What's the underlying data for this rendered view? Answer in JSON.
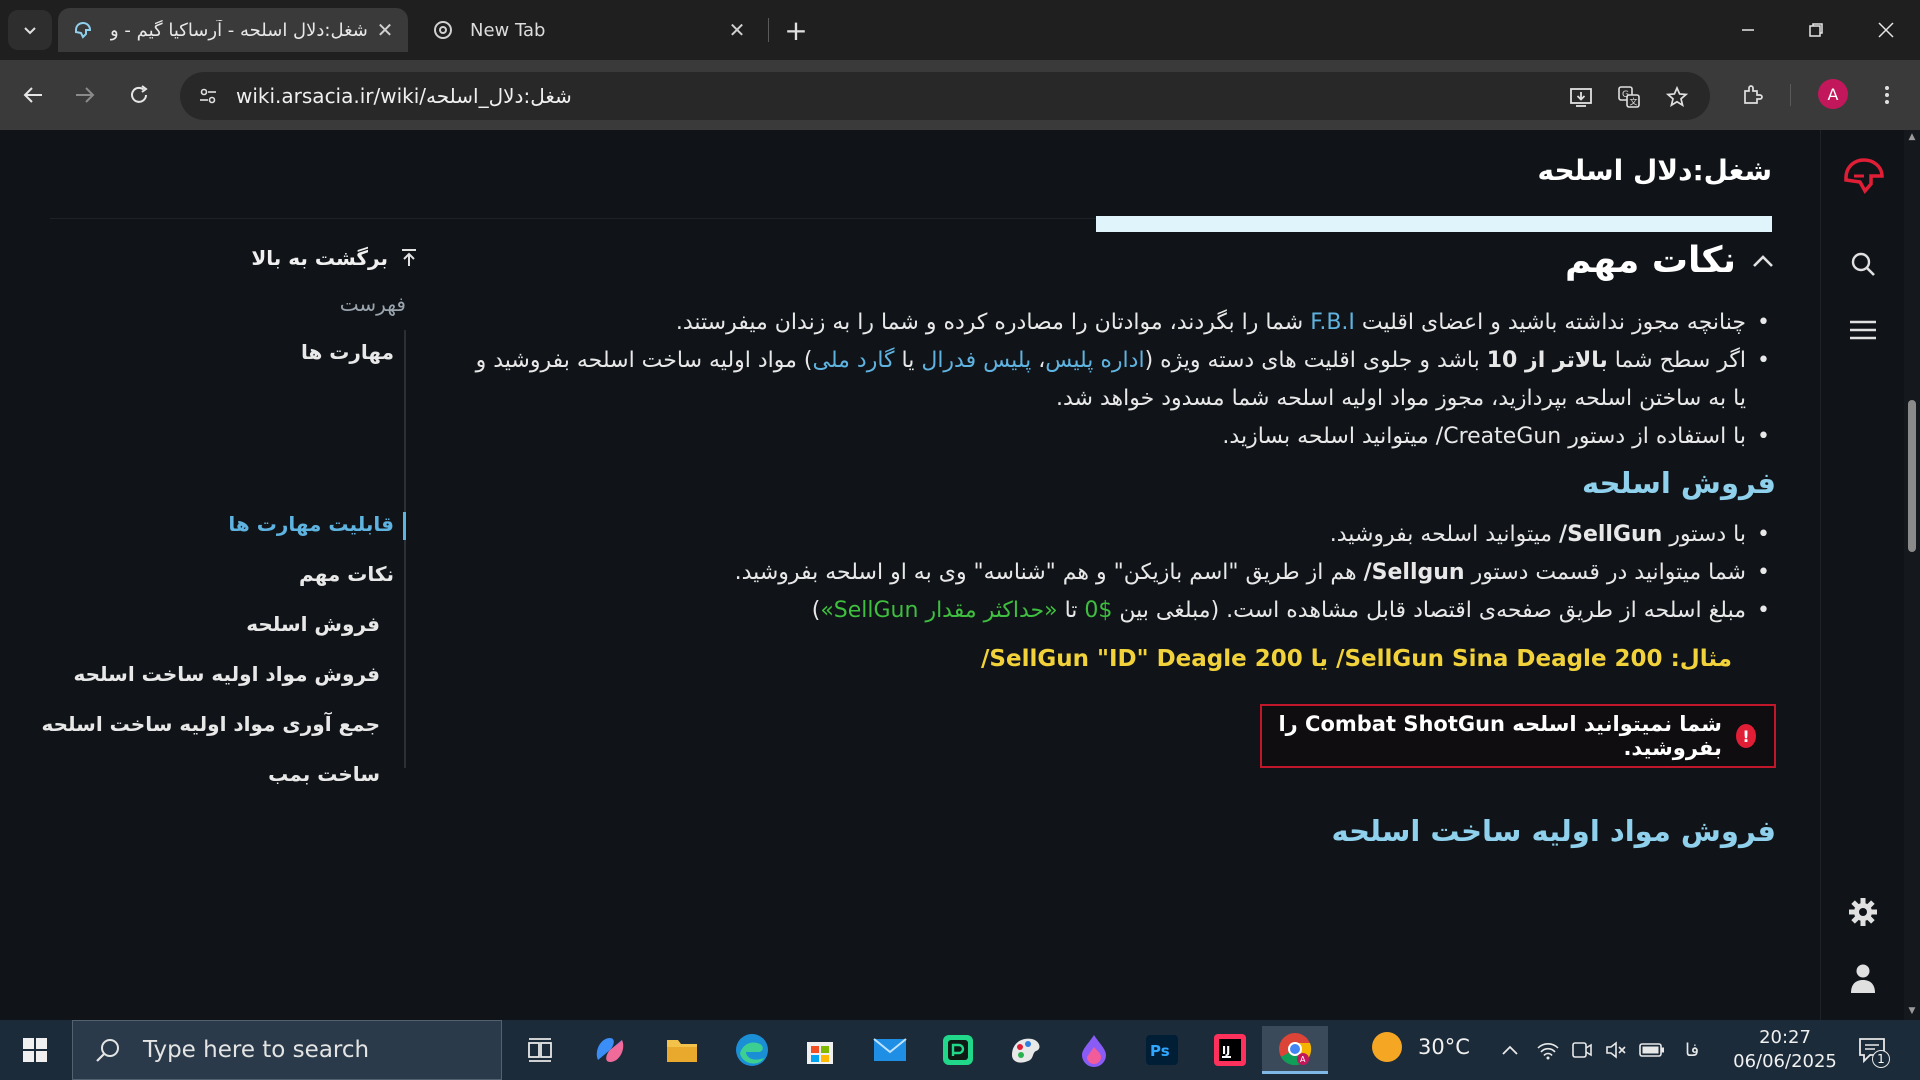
{
  "browser": {
    "tabs": [
      {
        "title": "شغل:دلال اسلحه - آرساکیا گیم - و",
        "active": true
      },
      {
        "title": "New Tab",
        "active": false
      }
    ],
    "url": "wiki.arsacia.ir/wiki/شغل:دلال_اسلحه",
    "profile_initial": "A",
    "icons": [
      "tab-search-icon",
      "new-tab-icon",
      "back-icon",
      "forward-icon",
      "reload-icon",
      "site-info-icon",
      "install-app-icon",
      "translate-icon",
      "star-icon",
      "extensions-icon",
      "menu-icon"
    ]
  },
  "page": {
    "title": "شغل:دلال اسلحه",
    "toc": {
      "back_to_top": "برگشت به بالا",
      "heading": "فهرست",
      "items": [
        "مهارت ها",
        "قابلیت مهارت ها",
        "نکات مهم",
        "فروش اسلحه",
        "فروش مواد اولیه ساخت اسلحه",
        "جمع آوری مواد اولیه ساخت اسلحه",
        "ساخت بمب"
      ]
    },
    "section_important": {
      "heading": "نکات مهم",
      "b1_pre": "چنانچه مجوز نداشته باشید و اعضای اقلیت ",
      "b1_link": "F.B.I",
      "b1_post": " شما را بگردند، موادتان را مصادره کرده و شما را به زندان میفرستند.",
      "b2_pre": "اگر سطح شما ",
      "b2_bold": "بالاتر از 10",
      "b2_mid": " باشد و جلوی اقلیت های دسته ویژه (",
      "b2_link1": "اداره پلیس",
      "b2_sep1": "، ",
      "b2_link2": "پلیس فدرال",
      "b2_sep2": " یا ",
      "b2_link3": "گارد ملی",
      "b2_post": ") مواد اولیه ساخت اسلحه بفروشید و یا به ساختن اسلحه بپردازید، مجوز مواد اولیه اسلحه شما مسدود خواهد شد.",
      "b3": "با استفاده از دستور CreateGun/ میتوانید اسلحه بسازید."
    },
    "section_sell": {
      "heading": "فروش اسلحه",
      "b1_pre": "با دستور ",
      "b1_bold": "SellGun/",
      "b1_post": " میتوانید اسلحه بفروشید.",
      "b2_pre": "شما میتوانید در قسمت دستور ",
      "b2_bold": "Sellgun/",
      "b2_post": " هم از طریق \"اسم بازیکن\" و هم \"شناسه\" وی به او اسلحه بفروشید.",
      "b3_pre": "مبلغ اسلحه از طریق صفحه‌ی اقتصاد قابل مشاهده است. (مبلغی بین ",
      "b3_money1": "$0",
      "b3_mid": " تا ",
      "b3_money2": "«حداکثر مقدار SellGun»",
      "b3_post": ")",
      "example": "مثال: SellGun Sina Deagle 200/ یا SellGun \"ID\" Deagle 200/",
      "warning": "شما نمیتوانید اسلحه Combat ShotGun را بفروشید.",
      "warning_badge": "!"
    },
    "section_materials": {
      "heading": "فروش مواد اولیه ساخت اسلحه"
    }
  },
  "taskbar": {
    "search_placeholder": "Type here to search",
    "weather": "30°C",
    "language": "فا",
    "time": "20:27",
    "date": "06/06/2025",
    "notification_count": "1"
  }
}
